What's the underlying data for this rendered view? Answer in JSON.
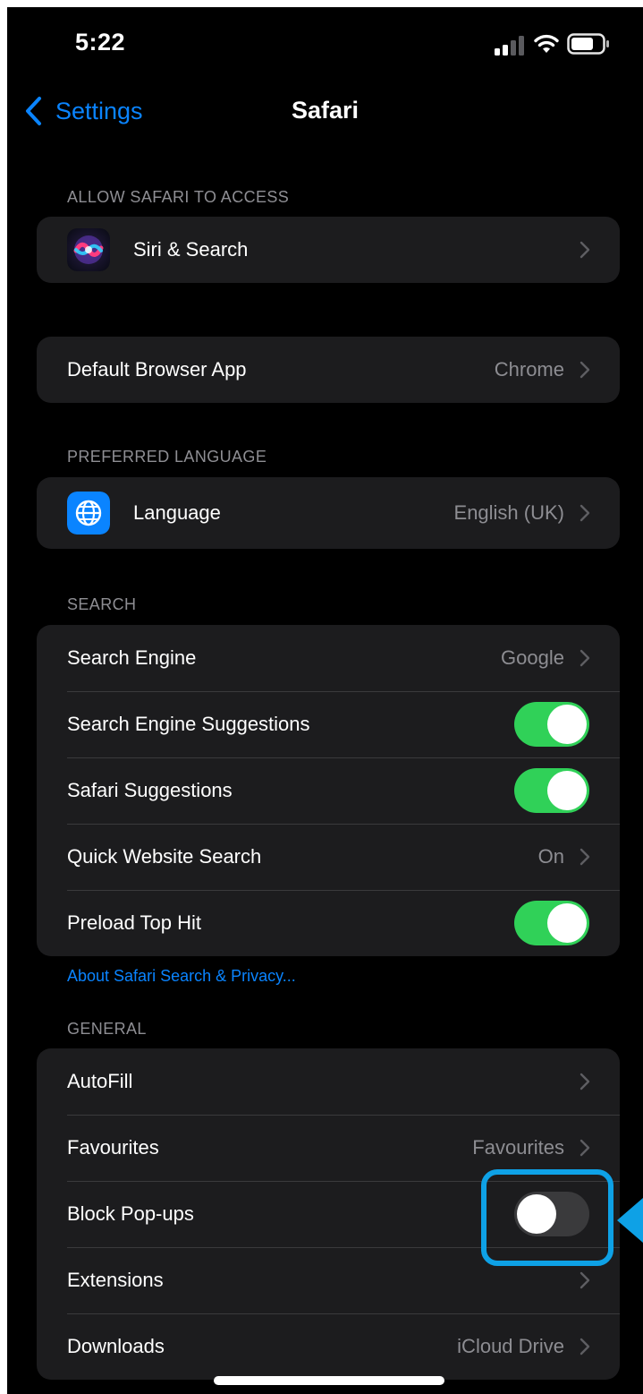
{
  "status_bar": {
    "time": "5:22"
  },
  "nav": {
    "back_label": "Settings",
    "title": "Safari"
  },
  "sections": {
    "allow_access": {
      "header": "ALLOW SAFARI TO ACCESS",
      "siri_label": "Siri & Search"
    },
    "default_browser": {
      "label": "Default Browser App",
      "value": "Chrome"
    },
    "preferred_language": {
      "header": "PREFERRED LANGUAGE",
      "label": "Language",
      "value": "English (UK)"
    },
    "search": {
      "header": "SEARCH",
      "search_engine": {
        "label": "Search Engine",
        "value": "Google"
      },
      "search_engine_suggestions": {
        "label": "Search Engine Suggestions",
        "on": true
      },
      "safari_suggestions": {
        "label": "Safari Suggestions",
        "on": true
      },
      "quick_website_search": {
        "label": "Quick Website Search",
        "value": "On"
      },
      "preload_top_hit": {
        "label": "Preload Top Hit",
        "on": true
      },
      "footer_link": "About Safari Search & Privacy..."
    },
    "general": {
      "header": "GENERAL",
      "autofill": {
        "label": "AutoFill"
      },
      "favourites": {
        "label": "Favourites",
        "value": "Favourites"
      },
      "block_popups": {
        "label": "Block Pop-ups",
        "on": false
      },
      "extensions": {
        "label": "Extensions"
      },
      "downloads": {
        "label": "Downloads",
        "value": "iCloud Drive"
      }
    }
  },
  "colors": {
    "background": "#000000",
    "group_background": "#1c1c1e",
    "accent_blue": "#0a84ff",
    "toggle_on": "#30d158",
    "toggle_off": "#3a3a3c",
    "highlight": "#0ea1e6"
  },
  "icons": [
    "signal-icon",
    "wifi-icon",
    "battery-icon",
    "back-chevron-icon",
    "siri-icon",
    "globe-icon",
    "chevron-right-icon"
  ]
}
